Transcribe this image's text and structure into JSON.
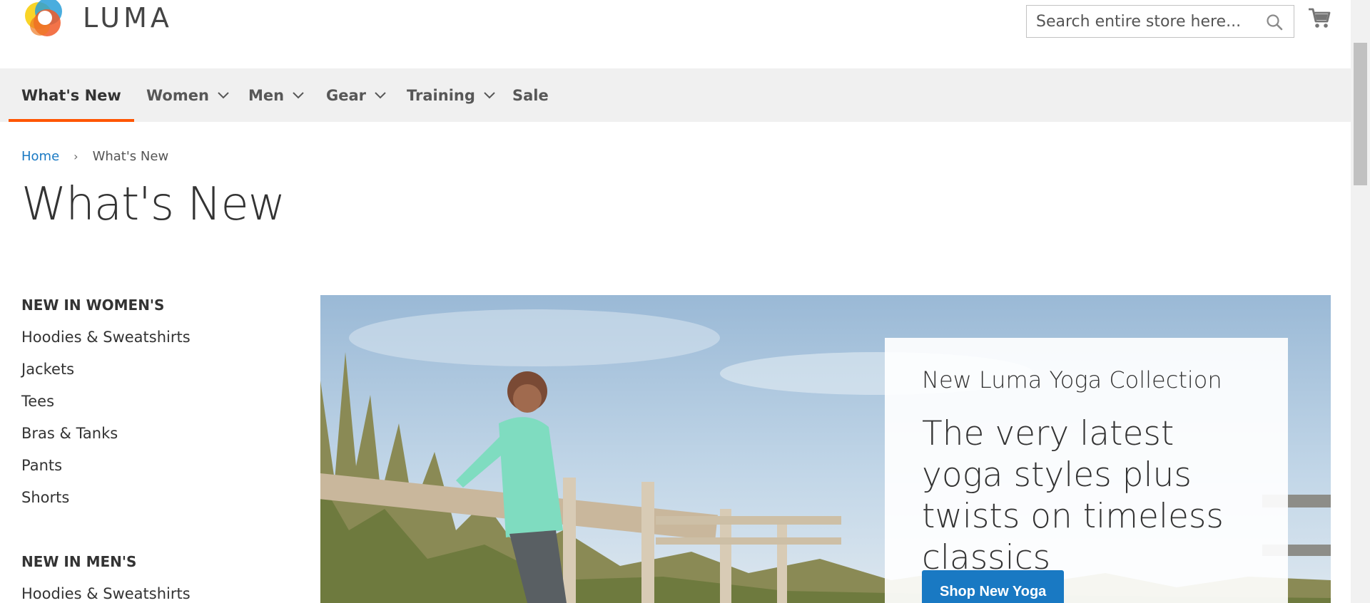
{
  "brand": {
    "name": "LUMA"
  },
  "search": {
    "placeholder": "Search entire store here..."
  },
  "nav": {
    "items": [
      {
        "label": "What's New"
      },
      {
        "label": "Women"
      },
      {
        "label": "Men"
      },
      {
        "label": "Gear"
      },
      {
        "label": "Training"
      },
      {
        "label": "Sale"
      }
    ]
  },
  "breadcrumb": {
    "home": "Home",
    "separator": "›",
    "current": "What's New"
  },
  "page": {
    "title": "What's New"
  },
  "sidebar": {
    "women_heading": "NEW IN WOMEN'S",
    "women_links": [
      "Hoodies & Sweatshirts",
      "Jackets",
      "Tees",
      "Bras & Tanks",
      "Pants",
      "Shorts"
    ],
    "men_heading": "NEW IN MEN'S",
    "men_links": [
      "Hoodies & Sweatshirts"
    ]
  },
  "hero": {
    "subtitle": "New Luma Yoga Collection",
    "title": "The very latest yoga styles plus twists on timeless classics",
    "button": "Shop New Yoga"
  },
  "colors": {
    "accent": "#ff5501",
    "link": "#1979c3",
    "nav_bg": "#f0f0f0"
  }
}
